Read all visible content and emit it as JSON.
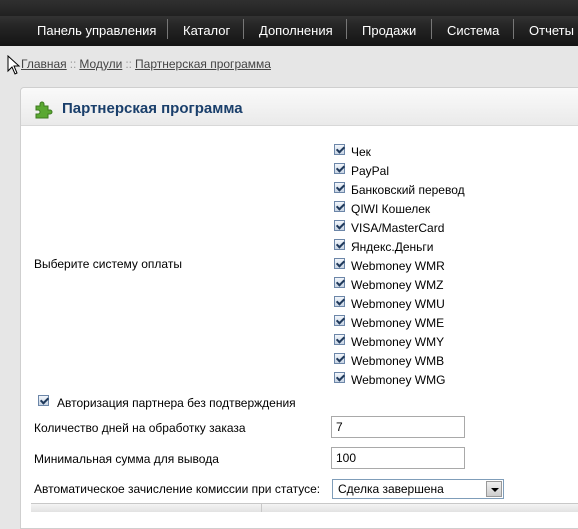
{
  "nav": {
    "items": [
      "Панель управления",
      "Каталог",
      "Дополнения",
      "Продажи",
      "Система",
      "Отчеты"
    ]
  },
  "breadcrumb": {
    "items": [
      "Главная",
      "Модули",
      "Партнерская программа"
    ],
    "separator": "::"
  },
  "panel": {
    "title": "Партнерская программа",
    "icon": "puzzle-piece-icon"
  },
  "form": {
    "payment_label": "Выберите систему оплаты",
    "payment_methods": [
      {
        "label": "Чек",
        "checked": true
      },
      {
        "label": "PayPal",
        "checked": true
      },
      {
        "label": "Банковский перевод",
        "checked": true
      },
      {
        "label": "QIWI Кошелек",
        "checked": true
      },
      {
        "label": "VISA/MasterCard",
        "checked": true
      },
      {
        "label": "Яндекс.Деньги",
        "checked": true
      },
      {
        "label": "Webmoney WMR",
        "checked": true
      },
      {
        "label": "Webmoney WMZ",
        "checked": true
      },
      {
        "label": "Webmoney WMU",
        "checked": true
      },
      {
        "label": "Webmoney WME",
        "checked": true
      },
      {
        "label": "Webmoney WMY",
        "checked": true
      },
      {
        "label": "Webmoney WMB",
        "checked": true
      },
      {
        "label": "Webmoney WMG",
        "checked": true
      }
    ],
    "auto_approve": {
      "label": "Авторизация партнера без подтверждения",
      "checked": true
    },
    "days_label": "Количество дней на обработку заказа",
    "days_value": "7",
    "min_sum_label": "Минимальная сумма для вывода",
    "min_sum_value": "100",
    "status_label": "Автоматическое зачисление комиссии при статусе:",
    "status_value": "Сделка завершена"
  },
  "colors": {
    "nav_bg": "#262626",
    "title": "#1a3f6b",
    "accent_green": "#5aa832"
  }
}
